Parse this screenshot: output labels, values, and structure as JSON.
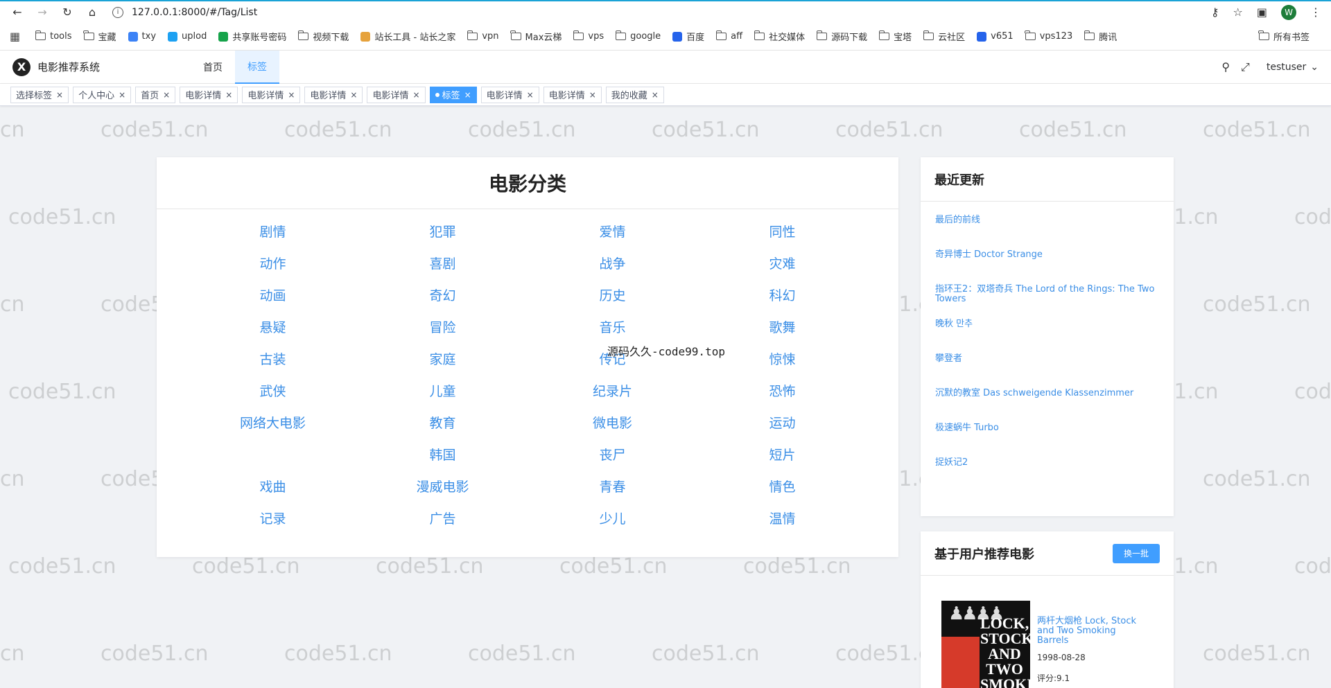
{
  "browser": {
    "url": "127.0.0.1:8000/#/Tag/List",
    "profile_initial": "W",
    "bookmarks": [
      "tools",
      "宝藏",
      "txy",
      "uplod",
      "共享账号密码",
      "视频下载",
      "站长工具 - 站长之家",
      "vpn",
      "Max云梯",
      "vps",
      "google",
      "百度",
      "aff",
      "社交媒体",
      "源码下载",
      "宝塔",
      "云社区",
      "v651",
      "vps123",
      "腾讯"
    ],
    "all_bookmarks": "所有书签"
  },
  "app": {
    "title": "电影推荐系统",
    "logo_mark": "X",
    "menu": [
      "首页",
      "标签"
    ],
    "username": "testuser"
  },
  "tabs": [
    "选择标签",
    "个人中心",
    "首页",
    "电影详情",
    "电影详情",
    "电影详情",
    "电影详情",
    "标签",
    "电影详情",
    "电影详情",
    "我的收藏"
  ],
  "active_tab_index": 7,
  "main": {
    "title": "电影分类",
    "categories": [
      "剧情",
      "犯罪",
      "爱情",
      "同性",
      "动作",
      "喜剧",
      "战争",
      "灾难",
      "动画",
      "奇幻",
      "历史",
      "科幻",
      "悬疑",
      "冒险",
      "音乐",
      "歌舞",
      "古装",
      "家庭",
      "传记",
      "惊悚",
      "武侠",
      "儿童",
      "纪录片",
      "恐怖",
      "网络大电影",
      "教育",
      "微电影",
      "运动",
      "",
      "韩国",
      "丧尸",
      "短片",
      "戏曲",
      "漫威电影",
      "青春",
      "情色",
      "记录",
      "广告",
      "少儿",
      "温情"
    ]
  },
  "recent": {
    "title": "最近更新",
    "items": [
      "最后的前线",
      "奇异博士 Doctor Strange",
      "指环王2：双塔奇兵 The Lord of the Rings: The Two Towers",
      "晚秋 만추",
      "攀登者",
      "沉默的教室 Das schweigende Klassenzimmer",
      "极速蜗牛 Turbo",
      "捉妖记2"
    ]
  },
  "recommend": {
    "title": "基于用户推荐电影",
    "swap_label": "换一批",
    "movie": {
      "title": "两杆大烟枪 Lock, Stock and Two Smoking Barrels",
      "date": "1998-08-28",
      "score": "评分:9.1",
      "poster_text": "LOCK, STOCK AND TWO SMOKING BARRELS"
    }
  },
  "watermark": "code51.cn",
  "center_watermark": "源码久久-code99.top"
}
